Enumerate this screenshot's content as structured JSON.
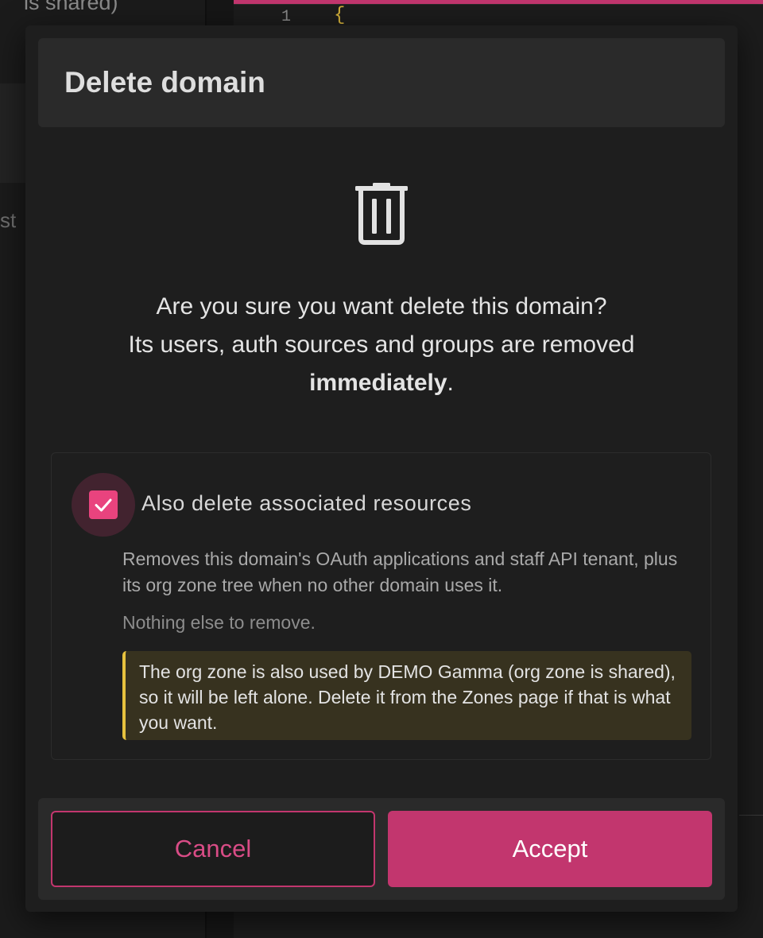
{
  "background": {
    "top_text": "is shared)",
    "side_text": "st",
    "editor_line_number": "1",
    "editor_first_char": "{"
  },
  "dialog": {
    "title": "Delete domain",
    "icon": "trash-icon",
    "message_line1": "Are you sure you want delete this domain?",
    "message_line2": "Its users, auth sources and groups are removed",
    "message_strong": "immediately",
    "message_end": ".",
    "option": {
      "checked": true,
      "label": "Also delete associated resources",
      "description": "Removes this domain's OAuth applications and staff API tenant, plus its org zone tree when no other domain uses it.",
      "note": "Nothing else to remove.",
      "warning": "The org zone is also used by DEMO Gamma (org zone is shared), so it will be left alone. Delete it from the Zones page if that is what you want."
    },
    "buttons": {
      "cancel": "Cancel",
      "accept": "Accept"
    }
  },
  "colors": {
    "accent": "#c2366e",
    "checkbox": "#e9437e",
    "warning_border": "#e7c23e",
    "warning_bg": "#37321f"
  }
}
